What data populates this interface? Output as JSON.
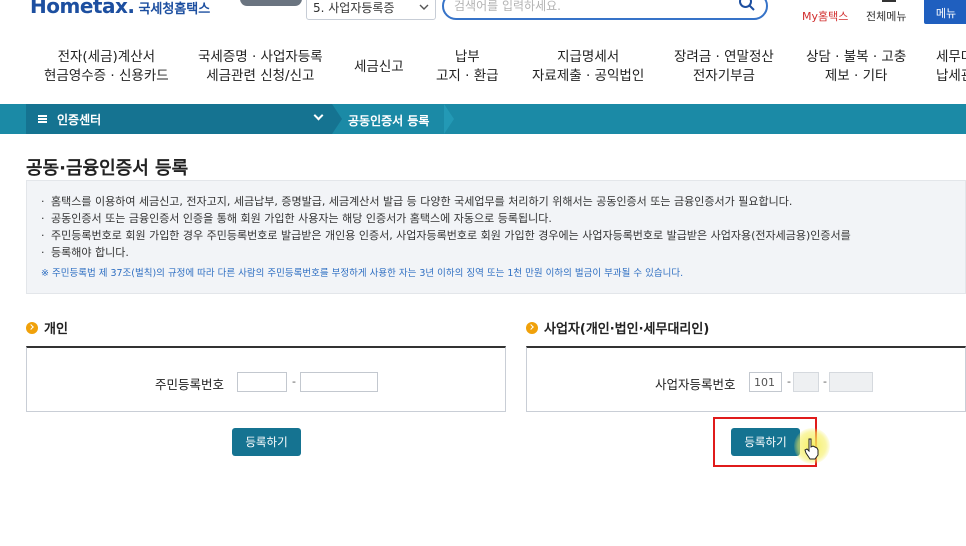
{
  "header": {
    "logo_en": "Hometax.",
    "logo_ko": "국세청홈택스",
    "search_select_value": "5. 사업자등록증",
    "search_placeholder": "검색어를 입력하세요.",
    "my_hometax": "My홈택스",
    "all_menu": "전체메뉴",
    "side_menu": "메뉴"
  },
  "gnb": [
    {
      "line1": "전자(세금)계산서",
      "line2": "현금영수증 · 신용카드"
    },
    {
      "line1": "국세증명 · 사업자등록",
      "line2": "세금관련 신청/신고"
    },
    {
      "line1": "세금신고",
      "line2": ""
    },
    {
      "line1": "납부",
      "line2": "고지 · 환급"
    },
    {
      "line1": "지급명세서",
      "line2": "자료제출 · 공익법인"
    },
    {
      "line1": "장려금 · 연말정산",
      "line2": "전자기부금"
    },
    {
      "line1": "상담 · 불복 · 고충",
      "line2": "제보 · 기타"
    },
    {
      "line1": "세무대",
      "line2": "납세관"
    }
  ],
  "location": {
    "menu": "인증센터",
    "current": "공동인증서 등록"
  },
  "page": {
    "title": "공동·금융인증서 등록"
  },
  "notice": {
    "items": [
      "홈택스를 이용하여 세금신고, 전자고지, 세금납부, 증명발급, 세금계산서 발급 등 다양한 국세업무를 처리하기 위해서는 공동인증서 또는 금융인증서가 필요합니다.",
      "공동인증서 또는 금융인증서 인증을 통해 회원 가입한 사용자는 해당 인증서가 홈택스에 자동으로 등록됩니다.",
      "주민등록번호로 회원 가입한 경우 주민등록번호로 발급받은 개인용 인증서, 사업자등록번호로 회원 가입한 경우에는 사업자등록번호로 발급받은 사업자용(전자세금용)인증서를",
      "등록해야 합니다."
    ],
    "warning": "※ 주민등록법 제 37조(벌칙)의 규정에 따라 다른 사람의 주민등록번호를 부정하게 사용한 자는 3년 이하의 징역 또는 1천 만원 이하의 벌금이 부과될 수 있습니다."
  },
  "personal": {
    "heading": "개인",
    "field_label": "주민등록번호",
    "dash": "-",
    "button": "등록하기"
  },
  "business": {
    "heading": "사업자(개인·법인·세무대리인)",
    "field_label": "사업자등록번호",
    "part1_value": "101",
    "dash": "-",
    "button": "등록하기"
  },
  "colors": {
    "accent": "#157391",
    "location_bar": "#1b8aa6",
    "highlight": "#e01b1b",
    "bullet": "#f0a10a"
  }
}
